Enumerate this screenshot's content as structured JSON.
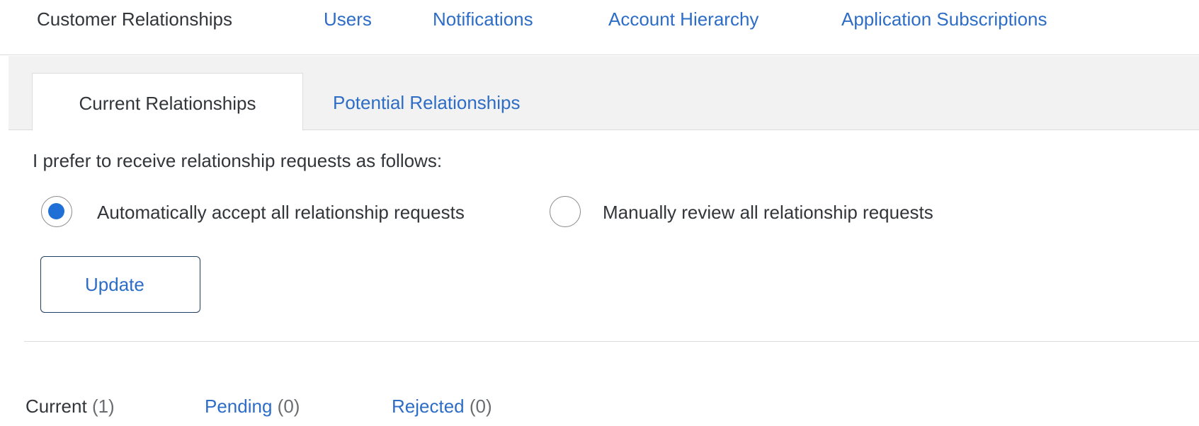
{
  "top_nav": {
    "items": [
      {
        "label": "Customer Relationships",
        "active": true
      },
      {
        "label": "Users",
        "active": false
      },
      {
        "label": "Notifications",
        "active": false
      },
      {
        "label": "Account Hierarchy",
        "active": false
      },
      {
        "label": "Application Subscriptions",
        "active": false
      }
    ]
  },
  "sub_tabs": {
    "items": [
      {
        "label": "Current Relationships",
        "active": true
      },
      {
        "label": "Potential Relationships",
        "active": false
      }
    ]
  },
  "preferences": {
    "prompt": "I prefer to receive relationship requests as follows:",
    "options": [
      {
        "label": "Automatically accept all relationship requests",
        "selected": true
      },
      {
        "label": "Manually review all relationship requests",
        "selected": false
      }
    ],
    "update_label": "Update"
  },
  "status_tabs": {
    "items": [
      {
        "label": "Current",
        "count": "(1)",
        "active": true
      },
      {
        "label": "Pending",
        "count": "(0)",
        "active": false
      },
      {
        "label": "Rejected",
        "count": "(0)",
        "active": false
      }
    ]
  },
  "colors": {
    "link": "#2d6dc6",
    "text": "#32363a",
    "radio_selected": "#1f6fd6",
    "tab_bar_background": "#f2f2f2"
  }
}
